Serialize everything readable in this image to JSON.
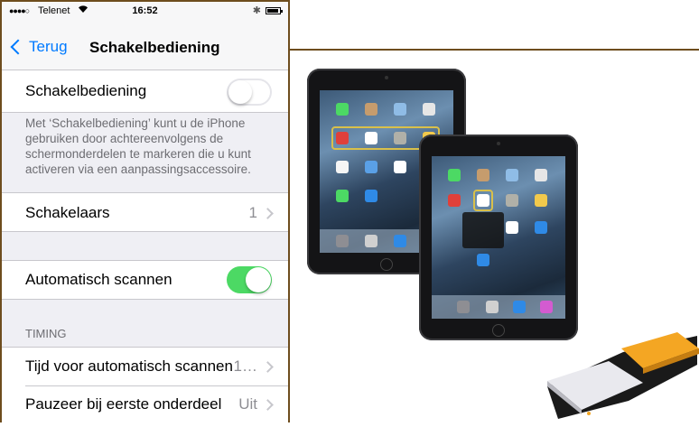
{
  "status_bar": {
    "signal": "●●●●○",
    "carrier": "Telenet",
    "wifi_icon": "wifi-icon",
    "time": "16:52",
    "bluetooth_icon": "bluetooth-icon",
    "battery_icon": "battery-icon"
  },
  "nav": {
    "back_label": "Terug",
    "title": "Schakelbediening"
  },
  "switch_control": {
    "label": "Schakelbediening",
    "enabled": false,
    "footer": "Met ‘Schakelbediening’ kunt u de iPhone gebruiken door achtereenvolgens de schermonderdelen te markeren die u kunt activeren via een aanpassingsaccessoire."
  },
  "switches": {
    "label": "Schakelaars",
    "value": "1"
  },
  "auto_scan": {
    "label": "Automatisch scannen",
    "enabled": true
  },
  "timing": {
    "header": "TIMING",
    "rows": [
      {
        "label": "Tijd voor automatisch scannen",
        "value": "1…"
      },
      {
        "label": "Pauzeer bij eerste onderdeel",
        "value": "Uit"
      }
    ]
  },
  "colors": {
    "accent": "#007aff",
    "toggle_on": "#4cd964",
    "frame": "#6e4d1e",
    "highlight": "#d9c04a",
    "switch_button_orange": "#f4a623"
  }
}
